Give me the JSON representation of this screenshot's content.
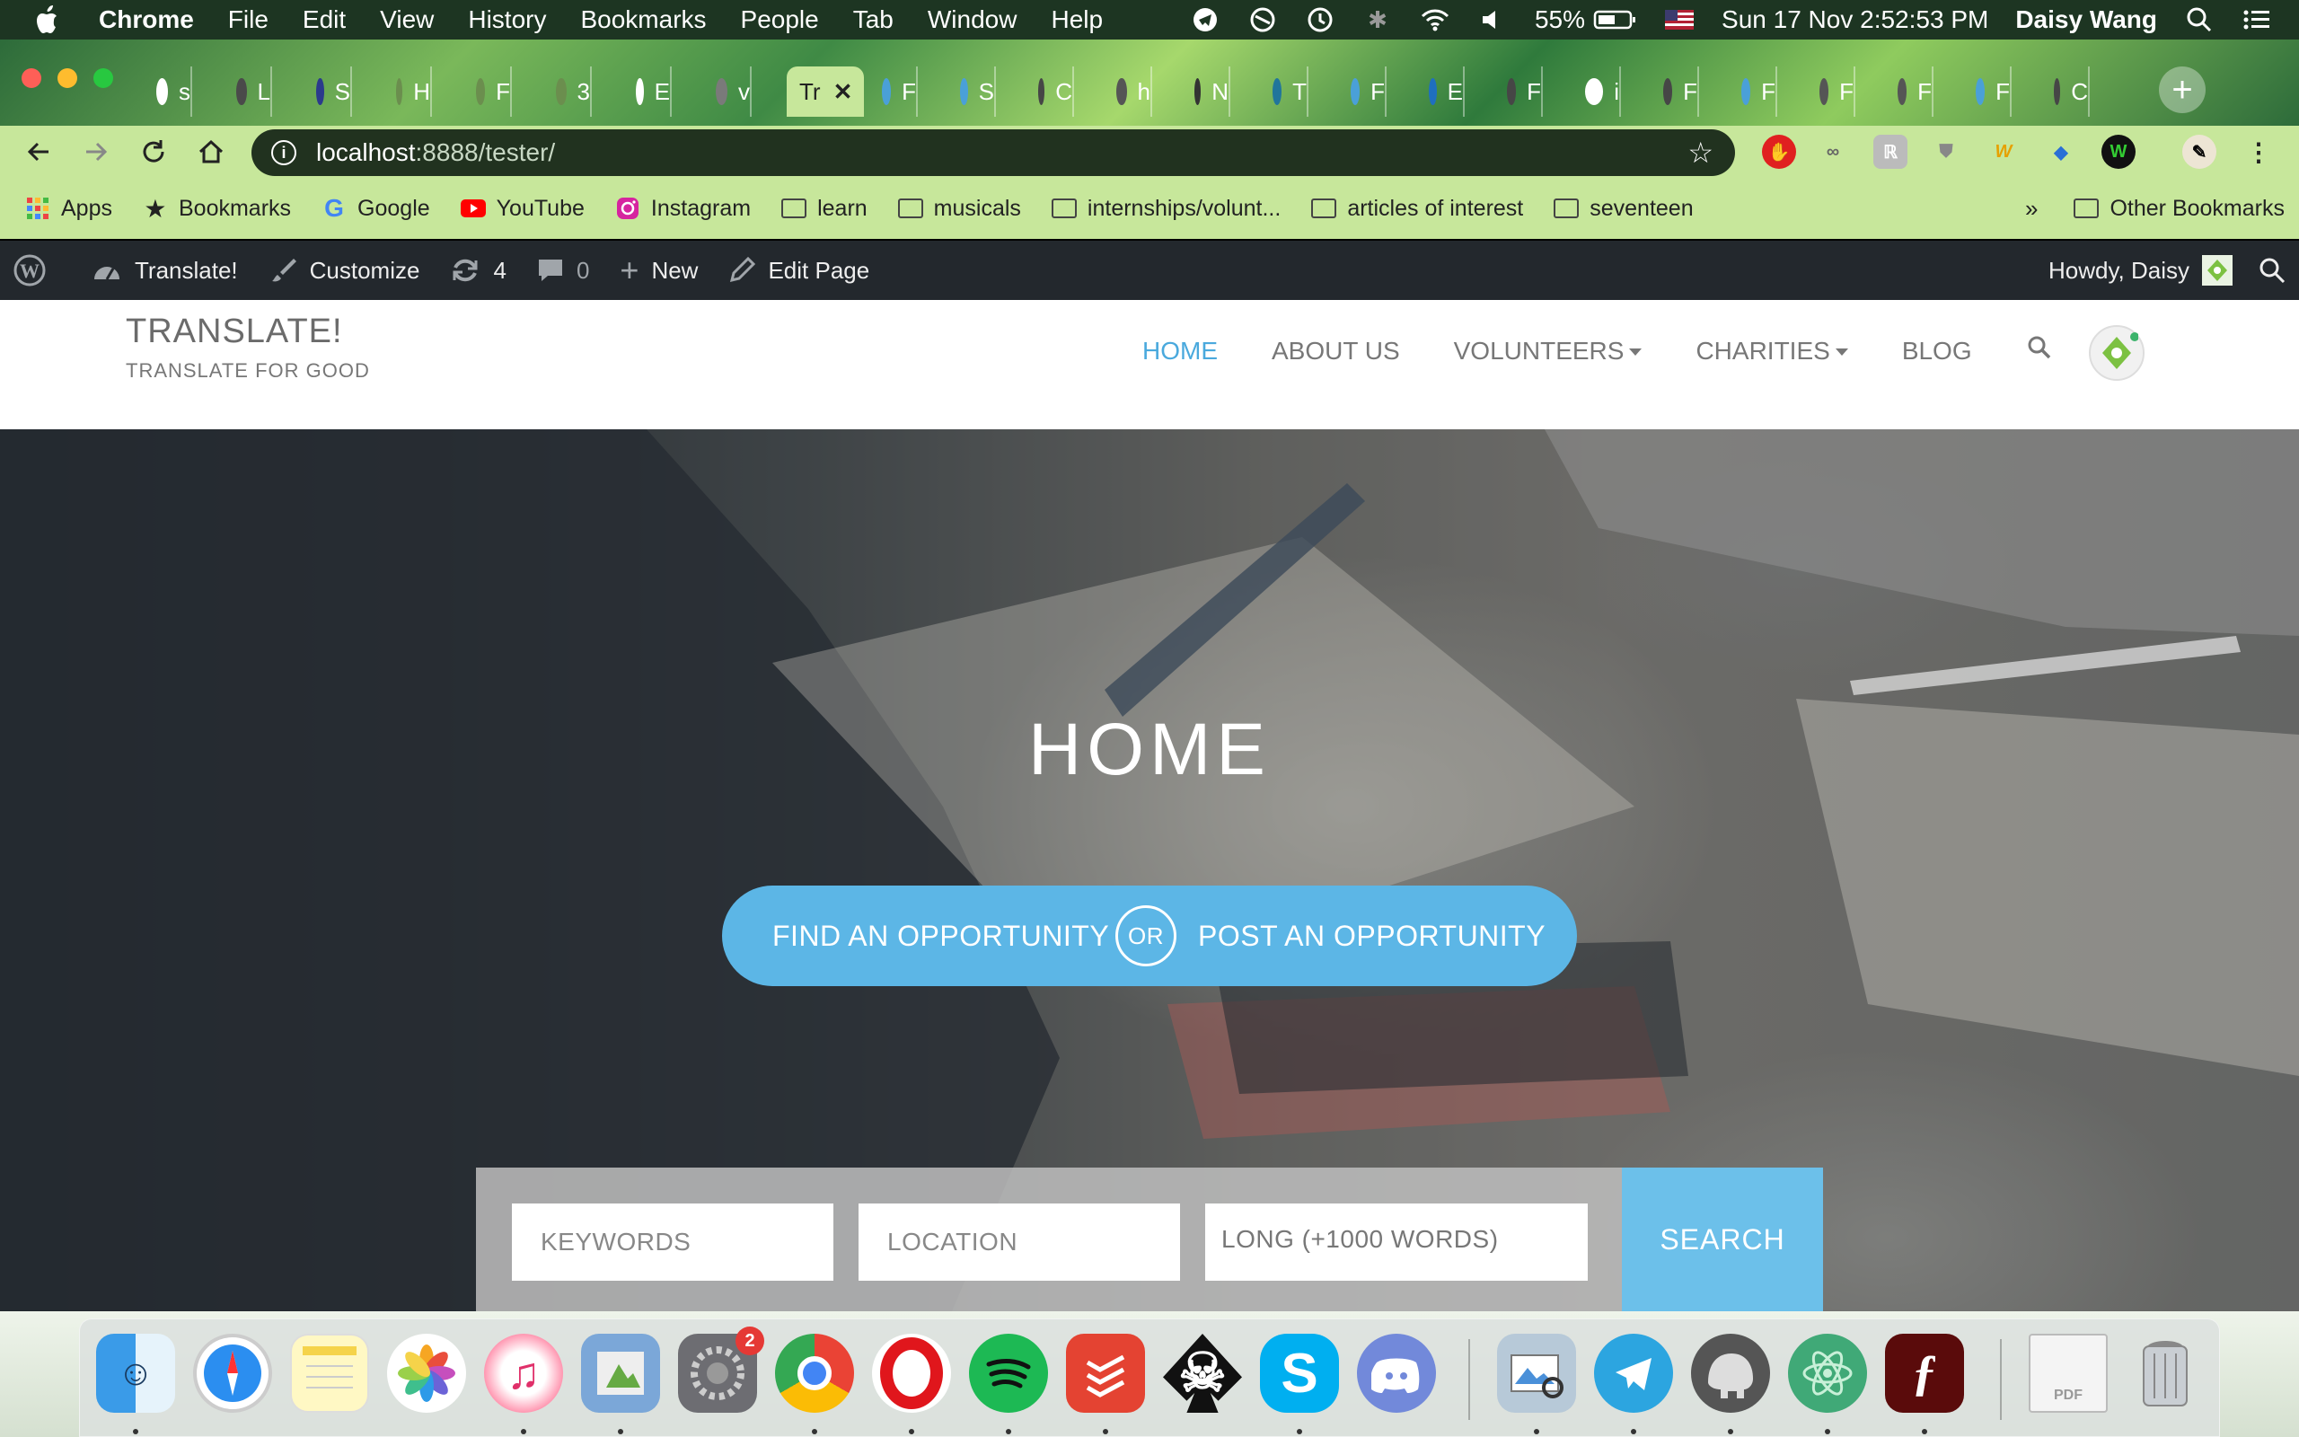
{
  "menubar": {
    "app_name": "Chrome",
    "menus": [
      "File",
      "Edit",
      "View",
      "History",
      "Bookmarks",
      "People",
      "Tab",
      "Window",
      "Help"
    ],
    "battery": "55%",
    "datetime": "Sun 17 Nov  2:52:53 PM",
    "user": "Daisy Wang"
  },
  "tabs": {
    "items": [
      {
        "icon": "google-icon",
        "label": "s",
        "color": "#ffffff"
      },
      {
        "icon": "dots-icon",
        "label": "L",
        "color": "#4a4a4a"
      },
      {
        "icon": "shield-icon",
        "label": "S",
        "color": "#2b3a8c"
      },
      {
        "icon": "atom-icon",
        "label": "H",
        "color": "#6b8e4e"
      },
      {
        "icon": "atom-icon",
        "label": "F",
        "color": "#6b8e4e"
      },
      {
        "icon": "atom-icon",
        "label": "3",
        "color": "#6b8e4e"
      },
      {
        "icon": "ts-icon",
        "label": "E",
        "color": "#ffffff"
      },
      {
        "icon": "elephant-icon",
        "label": "v",
        "color": "#7a7a7a"
      }
    ],
    "active": {
      "label": "Tr",
      "close": "✕"
    },
    "rest": [
      {
        "icon": "layers-icon",
        "label": "F",
        "color": "#4aa0d8"
      },
      {
        "icon": "layers-icon",
        "label": "S",
        "color": "#4aa0d8"
      },
      {
        "icon": "wordpress-icon",
        "label": "C",
        "color": "#464646"
      },
      {
        "icon": "globe-icon",
        "label": "h",
        "color": "#555555"
      },
      {
        "icon": "cloud-icon",
        "label": "N",
        "color": "#333333"
      },
      {
        "icon": "wordpress-icon",
        "label": "T",
        "color": "#21759b"
      },
      {
        "icon": "layers-icon",
        "label": "F",
        "color": "#4aa0d8"
      },
      {
        "icon": "codepixel-icon",
        "label": "E",
        "color": "#1f6fbf"
      },
      {
        "icon": "wordpress-icon",
        "label": "F",
        "color": "#464646"
      },
      {
        "icon": "google-icon",
        "label": "i",
        "color": "#ffffff"
      },
      {
        "icon": "wordpress-icon",
        "label": "F",
        "color": "#464646"
      },
      {
        "icon": "layers-icon",
        "label": "F",
        "color": "#4aa0d8"
      },
      {
        "icon": "globe-icon",
        "label": "F",
        "color": "#555555"
      },
      {
        "icon": "globe-icon",
        "label": "F",
        "color": "#555555"
      },
      {
        "icon": "layers-icon",
        "label": "F",
        "color": "#4aa0d8"
      },
      {
        "icon": "wordpress-icon",
        "label": "C",
        "color": "#464646"
      }
    ]
  },
  "toolbar": {
    "url_host": "localhost",
    "url_path": ":8888/tester/"
  },
  "bookmarks": {
    "items": [
      {
        "icon": "apps-grid-icon",
        "label": "Apps"
      },
      {
        "icon": "star-icon",
        "label": "Bookmarks"
      },
      {
        "icon": "google-icon",
        "label": "Google"
      },
      {
        "icon": "youtube-icon",
        "label": "YouTube"
      },
      {
        "icon": "instagram-icon",
        "label": "Instagram"
      },
      {
        "icon": "folder-icon",
        "label": "learn"
      },
      {
        "icon": "folder-icon",
        "label": "musicals"
      },
      {
        "icon": "folder-icon",
        "label": "internships/volunt..."
      },
      {
        "icon": "folder-icon",
        "label": "articles of interest"
      },
      {
        "icon": "folder-icon",
        "label": "seventeen"
      }
    ],
    "overflow": "»",
    "other": "Other Bookmarks"
  },
  "wpbar": {
    "site": "Translate!",
    "customize": "Customize",
    "updates": "4",
    "comments": "0",
    "new": "New",
    "edit": "Edit Page",
    "howdy": "Howdy, Daisy"
  },
  "site": {
    "title": "TRANSLATE!",
    "tagline": "TRANSLATE FOR GOOD",
    "nav": [
      {
        "label": "HOME",
        "active": true
      },
      {
        "label": "ABOUT US"
      },
      {
        "label": "VOLUNTEERS",
        "dropdown": true
      },
      {
        "label": "CHARITIES",
        "dropdown": true
      },
      {
        "label": "BLOG"
      }
    ]
  },
  "hero": {
    "title": "HOME",
    "find": "FIND AN OPPORTUNITY",
    "or": "OR",
    "post": "POST AN OPPORTUNITY",
    "keywords_placeholder": "KEYWORDS",
    "location_placeholder": "LOCATION",
    "length_value": "LONG (+1000 WORDS)",
    "search": "SEARCH"
  },
  "dock": {
    "apps": [
      "finder-icon",
      "safari-icon",
      "notes-icon",
      "photos-icon",
      "itunes-icon",
      "preview-icon",
      "system-preferences-icon",
      "chrome-icon",
      "opera-icon",
      "spotify-icon",
      "todoist-icon",
      "spade-icon",
      "skype-icon",
      "discord-icon",
      "image-capture-icon",
      "telegram-icon",
      "tableplus-icon",
      "atom-icon",
      "flash-icon",
      "pdf-document-icon",
      "trash-icon"
    ],
    "badge": "2"
  },
  "colors": {
    "accent": "#5cb6e6",
    "wp_bar": "#23282d",
    "chrome_theme": "#c7e79b"
  }
}
